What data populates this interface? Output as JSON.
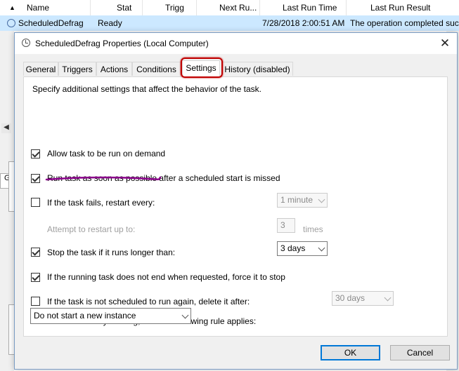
{
  "background": {
    "columns": [
      "Name",
      "Stat",
      "Trigg",
      "Next Ru...",
      "Last Run Time",
      "Last Run Result"
    ],
    "row": {
      "name": "ScheduledDefrag",
      "status": "Ready",
      "last_run_time": "7/28/2018 2:00:51 AM",
      "last_run_result": "The operation completed suc"
    },
    "left_tab_stub": "G"
  },
  "dialog": {
    "title": "ScheduledDefrag Properties (Local Computer)",
    "close_glyph": "✕",
    "tabs": [
      {
        "label": "General"
      },
      {
        "label": "Triggers"
      },
      {
        "label": "Actions"
      },
      {
        "label": "Conditions"
      },
      {
        "label": "Settings",
        "active": true
      },
      {
        "label": "History (disabled)"
      }
    ],
    "description": "Specify additional settings that affect the behavior of the task.",
    "settings": {
      "allow_on_demand": {
        "label": "Allow task to be run on demand",
        "checked": true
      },
      "run_asap": {
        "label": "Run task as soon as possible after a scheduled start is missed",
        "checked": true
      },
      "restart_on_fail": {
        "label": "If the task fails, restart every:",
        "checked": false,
        "interval": "1 minute"
      },
      "restart_attempts": {
        "label": "Attempt to restart up to:",
        "value": "3",
        "unit": "times"
      },
      "stop_if_longer": {
        "label": "Stop the task if it runs longer than:",
        "checked": true,
        "value": "3 days"
      },
      "force_stop": {
        "label": "If the running task does not end when requested, force it to stop",
        "checked": true
      },
      "delete_if_not_scheduled": {
        "label": "If the task is not scheduled to run again, delete it after:",
        "checked": false,
        "value": "30 days"
      },
      "running_rule": {
        "label": "If the task is already running, then the following rule applies:",
        "value": "Do not start a new instance"
      }
    },
    "buttons": {
      "ok": "OK",
      "cancel": "Cancel"
    }
  },
  "colors": {
    "highlight_box": "#c00000",
    "annotation_underline": "#8b008b",
    "selection_row": "#cce8ff",
    "focus_border": "#0078d7"
  }
}
